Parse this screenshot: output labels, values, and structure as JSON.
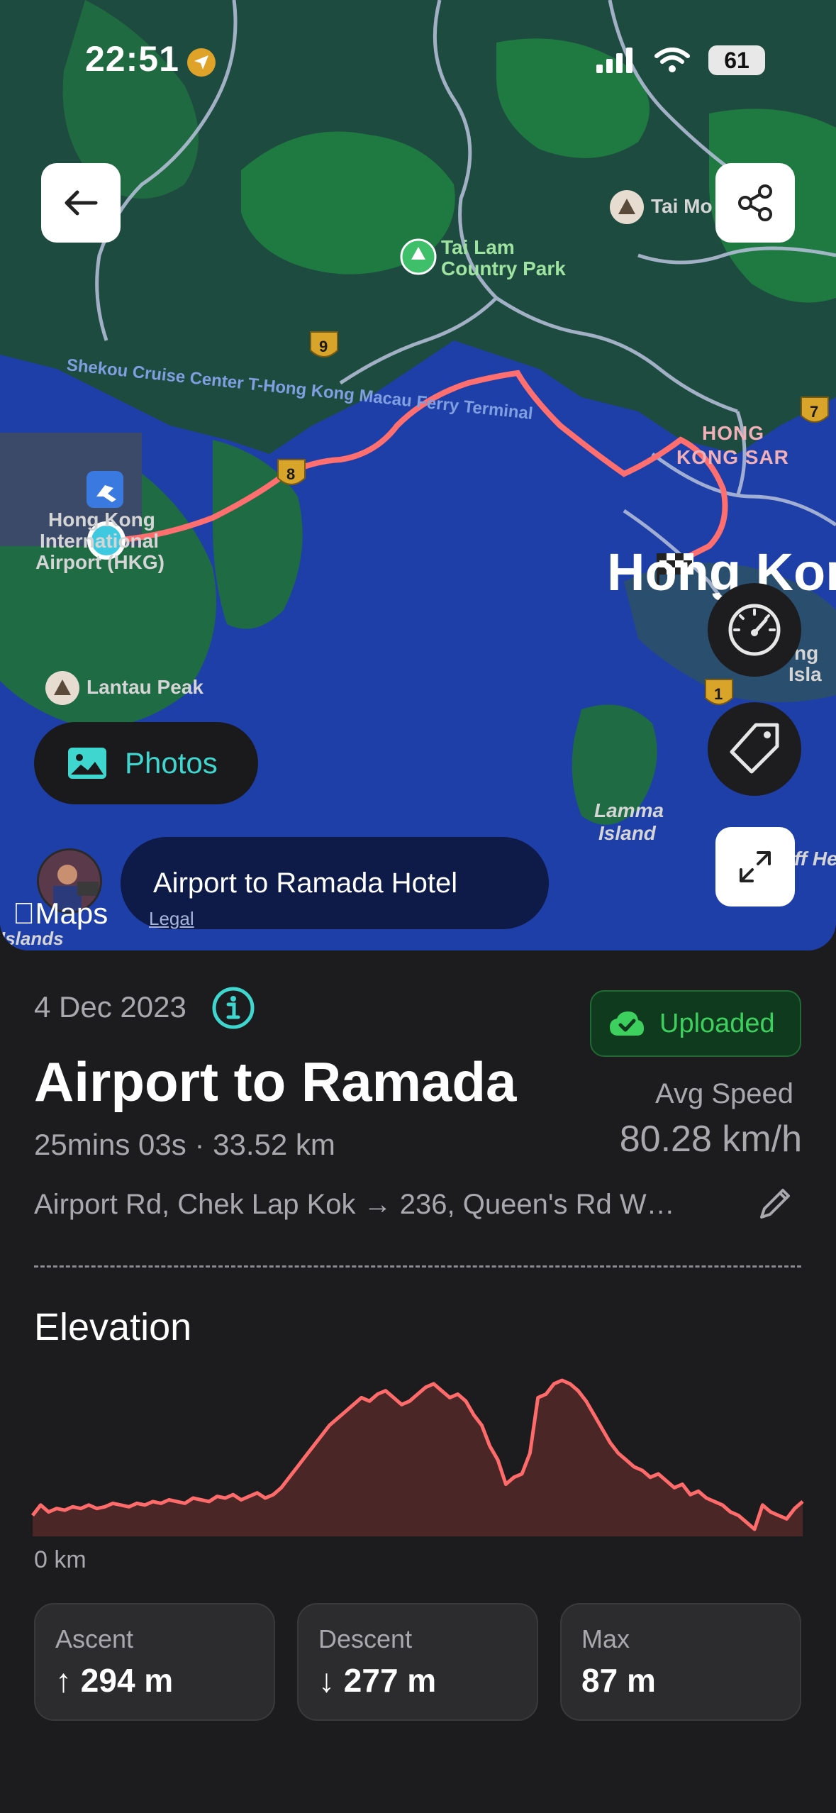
{
  "status_bar": {
    "time": "22:51",
    "battery": "61"
  },
  "map": {
    "labels": {
      "tai_mo": "Tai Mo",
      "tai_lam_1": "Tai Lam",
      "tai_lam_2": "Country Park",
      "ferry_road": "Shekou Cruise Center T-Hong Kong Macau Ferry Terminal",
      "airport_1": "Hong Kong",
      "airport_2": "International",
      "airport_3": "Airport (HKG)",
      "hk_sar_1": "HONG",
      "hk_sar_2": "KONG SAR",
      "hong_kong_big": "Hong Kong",
      "hk_island_1": "ng",
      "hk_island_2": "Isla",
      "lantau_peak": "Lantau Peak",
      "lamma_1": "Lamma",
      "lamma_2": "Island",
      "islands": "Islands",
      "off_he": "ff He",
      "route_9": "9",
      "route_8": "8",
      "route_7": "7",
      "route_1": "1"
    },
    "photos_label": "Photos",
    "title_pill": "Airport to Ramada Hotel",
    "maps_logo": "Maps",
    "legal": "Legal"
  },
  "trip": {
    "date": "4 Dec 2023",
    "upload_status": "Uploaded",
    "title": "Airport to Ramada",
    "meta": "25mins 03s · 33.52 km",
    "avg_speed_label": "Avg Speed",
    "avg_speed_value": "80.28 km/h",
    "route": "Airport Rd, Chek Lap Kok → 236, Queen's Rd W…"
  },
  "elevation": {
    "title": "Elevation",
    "axis_start": "0 km",
    "ascent_label": "Ascent",
    "ascent_value": "↑ 294 m",
    "descent_label": "Descent",
    "descent_value": "↓ 277 m",
    "max_label": "Max",
    "max_value": "87 m"
  },
  "chart_data": {
    "type": "area",
    "title": "Elevation",
    "x_start_label": "0 km",
    "max_m": 87,
    "values": [
      8,
      14,
      10,
      12,
      11,
      13,
      12,
      14,
      12,
      13,
      15,
      14,
      13,
      15,
      14,
      16,
      15,
      17,
      16,
      15,
      18,
      17,
      16,
      19,
      18,
      20,
      17,
      19,
      21,
      18,
      20,
      24,
      30,
      36,
      42,
      48,
      54,
      60,
      64,
      68,
      72,
      76,
      74,
      78,
      80,
      76,
      72,
      74,
      78,
      82,
      84,
      80,
      76,
      78,
      74,
      66,
      60,
      48,
      40,
      26,
      30,
      32,
      44,
      76,
      78,
      84,
      86,
      84,
      80,
      74,
      66,
      58,
      50,
      44,
      40,
      36,
      34,
      30,
      32,
      28,
      24,
      26,
      20,
      22,
      18,
      16,
      14,
      10,
      8,
      4,
      0,
      14,
      10,
      8,
      6,
      12,
      16
    ],
    "line_color": "#ff6b6b",
    "fill_color": "#4a2626"
  }
}
